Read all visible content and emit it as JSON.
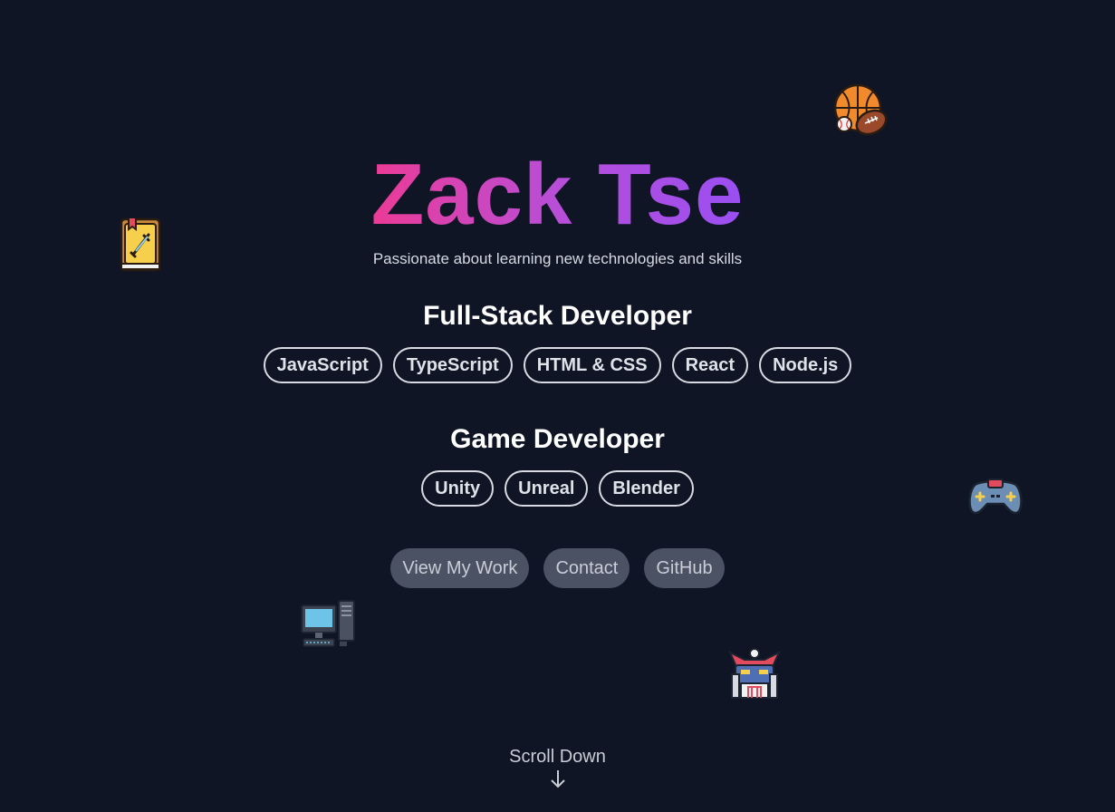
{
  "hero": {
    "name": "Zack Tse",
    "tagline": "Passionate about learning new technologies and skills"
  },
  "roles": [
    {
      "title": "Full-Stack Developer",
      "skills": [
        "JavaScript",
        "TypeScript",
        "HTML & CSS",
        "React",
        "Node.js"
      ]
    },
    {
      "title": "Game Developer",
      "skills": [
        "Unity",
        "Unreal",
        "Blender"
      ]
    }
  ],
  "actions": {
    "view_work": "View My Work",
    "contact": "Contact",
    "github": "GitHub"
  },
  "scroll": {
    "label": "Scroll Down"
  },
  "decorations": [
    "sports-balls-icon",
    "fantasy-book-icon",
    "game-controller-icon",
    "desktop-computer-icon",
    "robot-mecha-icon"
  ],
  "colors": {
    "background": "#0f1524",
    "gradient_start": "#ec3b96",
    "gradient_end": "#9a4ff2",
    "button_bg": "#4a5264"
  }
}
